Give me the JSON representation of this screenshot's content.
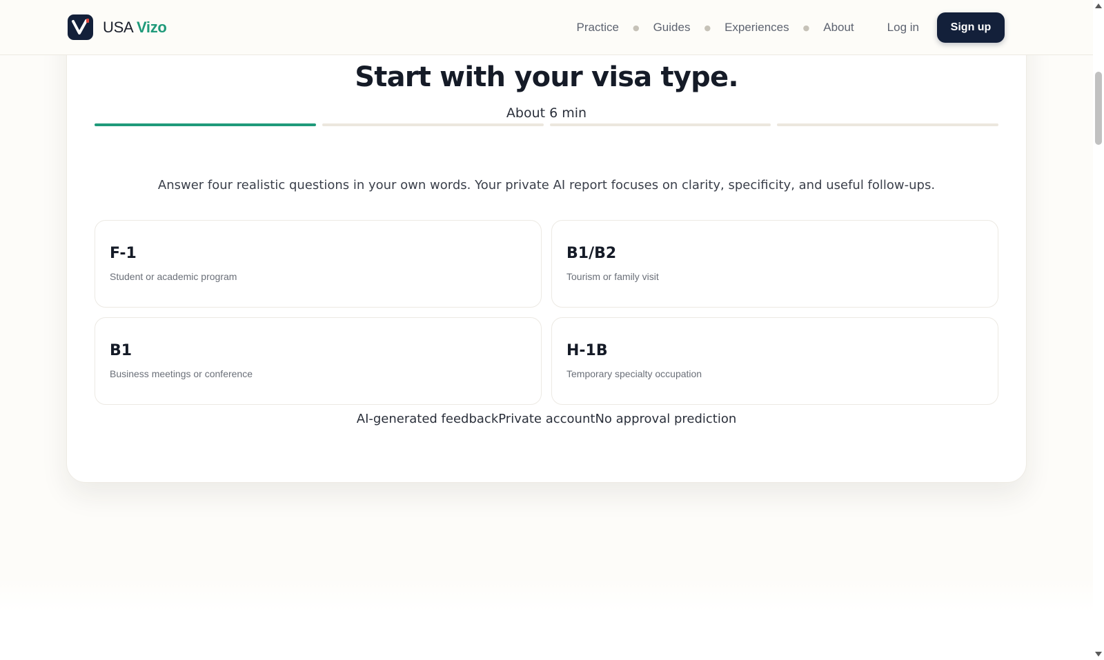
{
  "header": {
    "brand_primary": "USA",
    "brand_accent": "Vizo",
    "nav": [
      "Practice",
      "Guides",
      "Experiences",
      "About"
    ],
    "login_label": "Log in",
    "signup_label": "Sign up"
  },
  "main": {
    "title": "Start with your visa type.",
    "duration": "About 6 min",
    "progress": {
      "current_step": 1,
      "total_steps": 4
    },
    "intro": "Answer four realistic questions in your own words. Your private AI report focuses on clarity, specificity, and useful follow-ups.",
    "visa_types": [
      {
        "code": "F-1",
        "description": "Student or academic program"
      },
      {
        "code": "B1/B2",
        "description": "Tourism or family visit"
      },
      {
        "code": "B1",
        "description": "Business meetings or conference"
      },
      {
        "code": "H-1B",
        "description": "Temporary specialty occupation"
      }
    ],
    "footnotes": [
      "AI-generated feedback",
      "Private account",
      "No approval prediction"
    ]
  },
  "colors": {
    "accent": "#1f9a7a",
    "navy": "#13203a",
    "background": "#fdfcf9"
  },
  "icons": {
    "logo": "v-check-logo-icon"
  }
}
